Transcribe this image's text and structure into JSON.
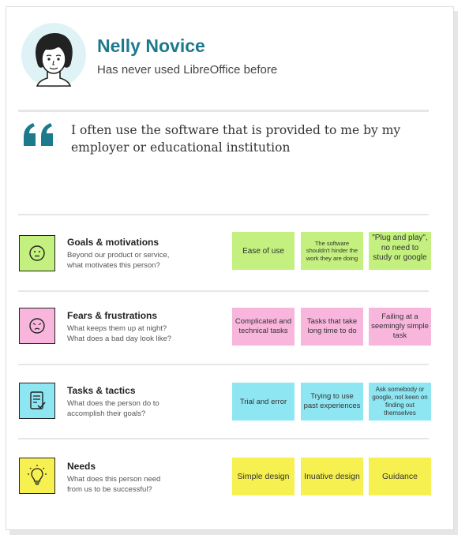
{
  "colors": {
    "accent": "#1c7a8c",
    "avatar_bg": "#dff3f6",
    "goals": "#c3f07e",
    "fears": "#f8b6dd",
    "tasks": "#8fe6f3",
    "needs": "#f6f150"
  },
  "persona": {
    "name": "Nelly Novice",
    "subtitle": "Has never used LibreOffice before",
    "avatar_icon": "woman-portrait-icon"
  },
  "quote": {
    "icon": "quotation-mark-icon",
    "line1": "I often use the software that is provided to me by my",
    "line2": "employer or educational institution"
  },
  "rows": [
    {
      "icon": "neutral-face-icon",
      "title": "Goals & motivations",
      "desc1": "Beyond our product or service,",
      "desc2": "what motivates this person?",
      "notes": [
        "Ease of use",
        "The software shouldn't hinder the work they are doing",
        "\"Plug and play\", no need to study or google"
      ]
    },
    {
      "icon": "worried-face-icon",
      "title": "Fears & frustrations",
      "desc1": "What keeps them up at night?",
      "desc2": "What does a bad day look like?",
      "notes": [
        "Complicated and technical tasks",
        "Tasks that take long time to do",
        "Failing at a seemingly simple task"
      ]
    },
    {
      "icon": "checklist-icon",
      "title": "Tasks & tactics",
      "desc1": "What does the person do to",
      "desc2": "accomplish their goals?",
      "notes": [
        "Trial and error",
        "Trying to use past experiences",
        "Ask somebody or google, not keen on finding out themselves"
      ]
    },
    {
      "icon": "lightbulb-icon",
      "title": "Needs",
      "desc1": "What does this person need",
      "desc2": "from us to be successful?",
      "notes": [
        "Simple design",
        "Inuative design",
        "Guidance"
      ]
    }
  ]
}
